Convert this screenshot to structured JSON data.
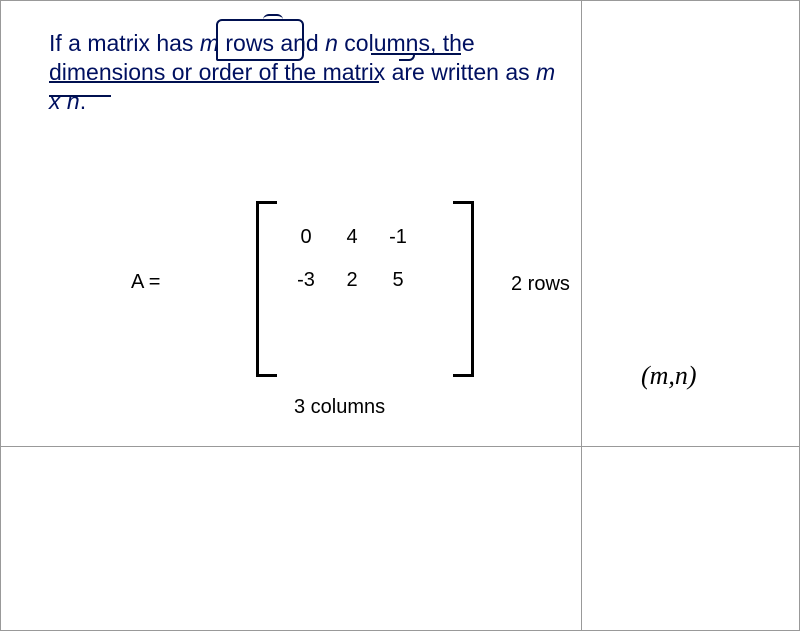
{
  "intro": {
    "part1": "If a matrix has ",
    "m": "m",
    "part2": " rows and ",
    "n": "n",
    "part3": " columns, the dimensions or order of the matrix are written as ",
    "mxn": "m x n",
    "period": "."
  },
  "matrix": {
    "label": "A =",
    "rows": [
      [
        "0",
        "4",
        "-1"
      ],
      [
        "-3",
        "2",
        "5"
      ]
    ],
    "rows_label": "2 rows",
    "cols_label": "3 columns",
    "mn_label": "(m,n)"
  }
}
